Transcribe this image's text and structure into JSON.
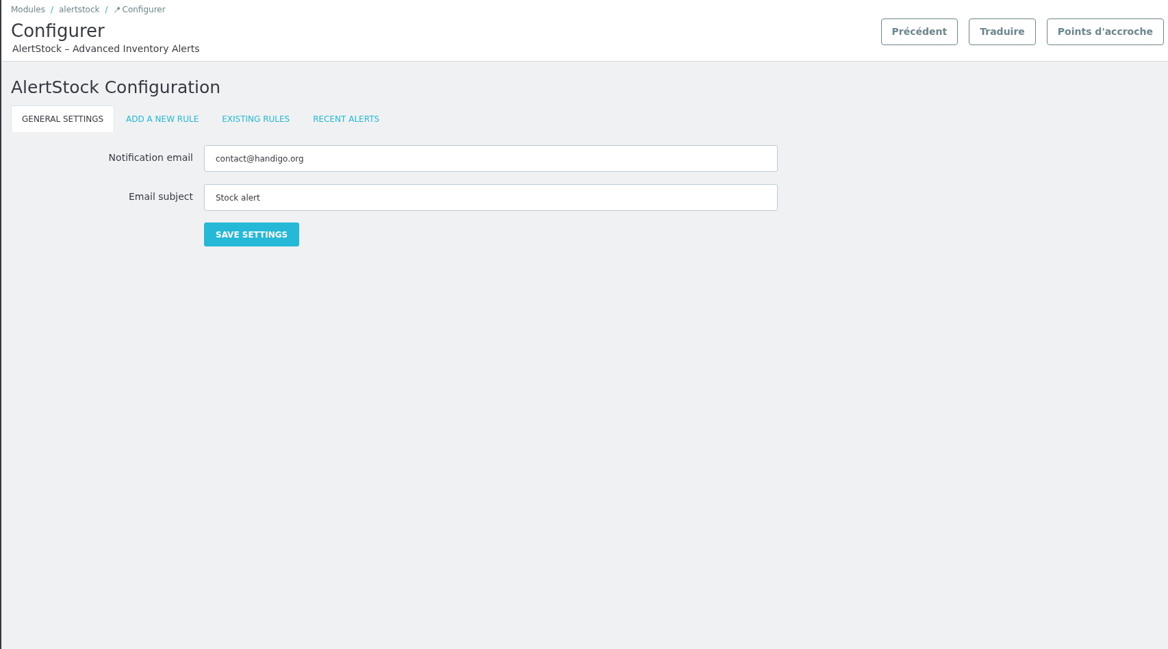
{
  "breadcrumb_separator": "/",
  "breadcrumb": [
    {
      "label": "Modules"
    },
    {
      "label": "alertstock"
    },
    {
      "label": "Configurer",
      "icon": true
    }
  ],
  "header": {
    "title": "Configurer",
    "subtitle": "AlertStock – Advanced Inventory Alerts"
  },
  "toolbar_buttons": [
    "Précédent",
    "Traduire",
    "Points d'accroche"
  ],
  "panel_title": "AlertStock Configuration",
  "tabs": [
    {
      "label": "GENERAL SETTINGS",
      "selected": true
    },
    {
      "label": "ADD A NEW RULE",
      "selected": false
    },
    {
      "label": "EXISTING RULES",
      "selected": false
    },
    {
      "label": "RECENT ALERTS",
      "selected": false
    }
  ],
  "fields": [
    {
      "label": "Notification email",
      "value": "contact@handigo.org"
    },
    {
      "label": "Email subject",
      "value": "Stock alert"
    }
  ],
  "save_button": "SAVE SETTINGS"
}
